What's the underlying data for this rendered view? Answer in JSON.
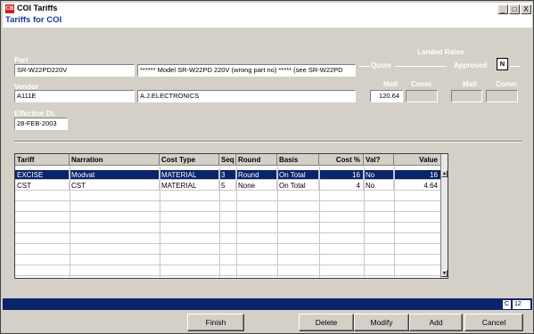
{
  "window": {
    "app_icon": "CB",
    "title": "COI Tariffs",
    "controls": [
      "_",
      "□",
      "X"
    ]
  },
  "form_title": "Tariffs for COI",
  "part": {
    "label": "Part",
    "code": "SR-W22PD220V",
    "description": "****** Model SR-W22PD 220V (wrong part no) ***** (see SR-W22PD"
  },
  "vendor": {
    "label": "Vendor",
    "code": "A111E",
    "name": "A.J.ELECTRONICS"
  },
  "effective_dt": {
    "label": "Effective Dt.",
    "value": "28-FEB-2003"
  },
  "landed_rates": {
    "label": "Landed Rates",
    "quote_label": "Quote",
    "approved_label": "Approved",
    "approved_flag": "N",
    "quote_matl_label": "Matl",
    "quote_convr_label": "Convr.",
    "quote_matl_value": "120.64",
    "quote_convr_value": "",
    "approved_matl_label": "Matl",
    "approved_convr_label": "Convr.",
    "approved_matl_value": "",
    "approved_convr_value": ""
  },
  "grid": {
    "columns": [
      "Tariff",
      "Narration",
      "Cost Type",
      "Seq",
      "Round",
      "Basis",
      "Cost %",
      "Val?",
      "Value"
    ],
    "rows": [
      {
        "tariff": "EXCISE",
        "narration": "Modvat",
        "cost_type": "MATERIAL",
        "seq": "3",
        "round": "Round",
        "basis": "On Total",
        "cost_pct": "16",
        "val": "No",
        "value": "16"
      },
      {
        "tariff": "CST",
        "narration": "CST",
        "cost_type": "MATERIAL",
        "seq": "5",
        "round": "None",
        "basis": "On Total",
        "cost_pct": "4",
        "val": "No",
        "value": "4.64"
      }
    ],
    "selected_row": 0
  },
  "status": {
    "mode": "C",
    "number": "12"
  },
  "buttons": {
    "finish": "Finish",
    "delete": "Delete",
    "modify": "Modify",
    "add": "Add",
    "cancel": "Cancel"
  },
  "colors": {
    "window_bg": "#d4d0c8",
    "selection": "#0a246a",
    "form_title": "#1a3a9a"
  }
}
